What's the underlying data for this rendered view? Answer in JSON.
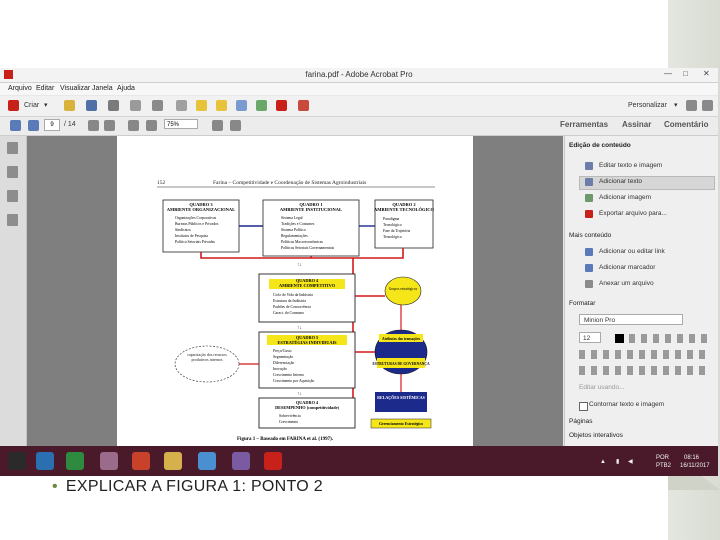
{
  "window": {
    "title": "farina.pdf - Adobe Acrobat Pro"
  },
  "menu": [
    "Arquivo",
    "Editar",
    "Visualizar",
    "Janela",
    "Ajuda"
  ],
  "toolbar": {
    "create_label": "Criar",
    "customize_label": "Personalizar",
    "page_current": "9",
    "page_total": "/ 14",
    "zoom": "75%",
    "tabs": [
      "Ferramentas",
      "Assinar",
      "Comentário"
    ]
  },
  "document": {
    "header_page_number": "152",
    "header_title": "Farina – Competitividade e Coordenação de Sistemas Agroindustriais",
    "figure_caption": "Figura 1 – Baseado em FARINA et al. (1997).",
    "quadro3": {
      "title": "QUADRO 3",
      "subtitle": "AMBIENTE ORGANIZACIONAL",
      "items": [
        "Organizações Corporativas",
        "Bureaus Públicos e Privados",
        "Sindicatos",
        "Institutos de Pesquisa",
        "Política Setoriais Privadas"
      ]
    },
    "quadro1": {
      "title": "QUADRO 1",
      "subtitle": "AMBIENTE INSTITUCIONAL",
      "items": [
        "Sistema Legal",
        "Tradições e Costumes",
        "Sistema Político",
        "Regulamentações",
        "Políticas Macroeconômicas",
        "Políticas Setoriais Governamentais"
      ]
    },
    "quadro2": {
      "title": "QUADRO 2",
      "subtitle": "AMBIENTE TECNOLÓGICO",
      "items": [
        "Paradigma",
        "Tecnológico",
        "Fase da Trajetória",
        "Tecnológica"
      ]
    },
    "quadro4a": {
      "title": "QUADRO 4",
      "subtitle": "AMBIENTE COMPETITIVO",
      "items": [
        "Ciclo de Vida da Indústria",
        "Estrutura da Indústria",
        "Padrões de Concorrência",
        "Caract. do Consumo"
      ]
    },
    "quadro5": {
      "title": "QUADRO 5",
      "subtitle": "ESTRATÉGIAS INDIVIDUAIS",
      "items": [
        "Preço/Custo",
        "Segmentação",
        "Diferenciação",
        "Inovação",
        "Crescimento Interno",
        "Crescimento por Aquisição"
      ]
    },
    "quadro4b": {
      "title": "QUADRO 4",
      "subtitle": "DESEMPENHO (competitividade)",
      "items": [
        "Sobrevivência",
        "Crescimento"
      ]
    },
    "grupos": "Grupos estratégicos",
    "atributos": "Atributos das transações",
    "estruturas": "ESTRUTURAS DE GOVERNANÇA",
    "capacitacao": "capacitação dos recursos produtivos internos",
    "relacoes": "RELAÇÕES SISTÊMICAS",
    "gerenciamento": "Gerenciamento Estratégico"
  },
  "right_panel": {
    "section1": "Edição de conteúdo",
    "edit_items": [
      "Editar texto e imagem",
      "Adicionar texto",
      "Adicionar imagem",
      "Exportar arquivo para..."
    ],
    "section2": "Mais conteúdo",
    "more_items": [
      "Adicionar ou editar link",
      "Adicionar marcador",
      "Anexar um arquivo"
    ],
    "format_label": "Formatar",
    "font_name": "Minion Pro",
    "font_size": "12",
    "edit_using": "Editar usando...",
    "clip_label": "Contornar texto e imagem",
    "section3": "Páginas",
    "section4": "Objetos interativos"
  },
  "taskbar": {
    "lang1": "POR",
    "lang2": "PTB2",
    "time": "08:16",
    "date": "16/11/2017"
  },
  "slide": {
    "bullet_text": "EXPLICAR A FIGURA 1: PONTO 2"
  },
  "colors": {
    "red_arrow": "#d11a1a",
    "yellow": "#f5e61a",
    "navy": "#1c2a8c",
    "taskbar": "#4a1a2a"
  }
}
